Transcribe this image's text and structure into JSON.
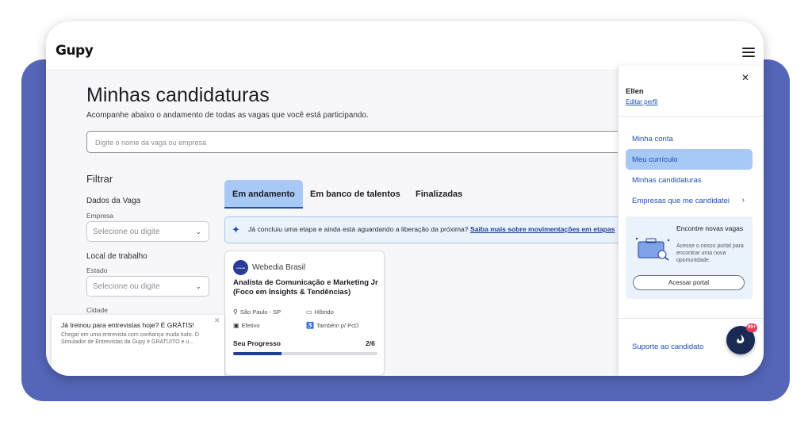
{
  "app": {
    "logo": "Gupy"
  },
  "header": {
    "title": "Minhas candidaturas",
    "subtitle": "Acompanhe abaixo o andamento de todas as vagas que você está participando."
  },
  "search": {
    "placeholder": "Digite o nome da vaga ou empresa"
  },
  "filters": {
    "title": "Filtrar",
    "job_section": "Dados da Vaga",
    "company_label": "Empresa",
    "company_placeholder": "Selecione ou digite",
    "location_section": "Local de trabalho",
    "state_label": "Estado",
    "state_placeholder": "Selecione ou digite",
    "city_label": "Cidade"
  },
  "tabs": [
    {
      "label": "Em andamento",
      "active": true
    },
    {
      "label": "Em banco de talentos",
      "active": false
    },
    {
      "label": "Finalizadas",
      "active": false
    }
  ],
  "info_banner": {
    "text": "Já concluiu uma etapa e ainda está aguardando a liberação da próxima?",
    "link": "Saiba mais sobre movimentações em etapas"
  },
  "application_card": {
    "company_logo_text": "webedia",
    "company": "Webedia Brasil",
    "job_title": "Analista de Comunicação e Marketing Jr (Foco em Insights & Tendências)",
    "location": "São Paulo - SP",
    "work_model": "Híbrido",
    "contract": "Efetivo",
    "pcd": "Também p/ PcD",
    "progress_label": "Seu Progresso",
    "progress_text": "2/6",
    "progress_fraction": 0.333
  },
  "toast": {
    "title": "Já treinou para entrevistas hoje? É GRÁTIS!",
    "body": "Chegar em uma entrevista com confiança muda tudo. O Simulador de Entrevistas da Gupy é GRATUITO e u..."
  },
  "drawer": {
    "user_name": "Ellen",
    "edit_profile": "Editar perfil",
    "items": [
      {
        "label": "Minha conta",
        "active": false
      },
      {
        "label": "Meu currículo",
        "active": true
      },
      {
        "label": "Minhas candidaturas",
        "active": false
      },
      {
        "label": "Empresas que me candidatei",
        "active": false
      }
    ],
    "promo_title": "Encontre novas vagas",
    "promo_text": "Acesse o nosso portal para encontrar uma nova oportunidade.",
    "promo_button": "Acessar portal",
    "support": "Suporte ao candidato"
  },
  "fab": {
    "badge": "99+"
  },
  "colors": {
    "brand_blue": "#1f4fb4",
    "accent_light": "#a8c8f5",
    "background_block": "#5566b8"
  }
}
